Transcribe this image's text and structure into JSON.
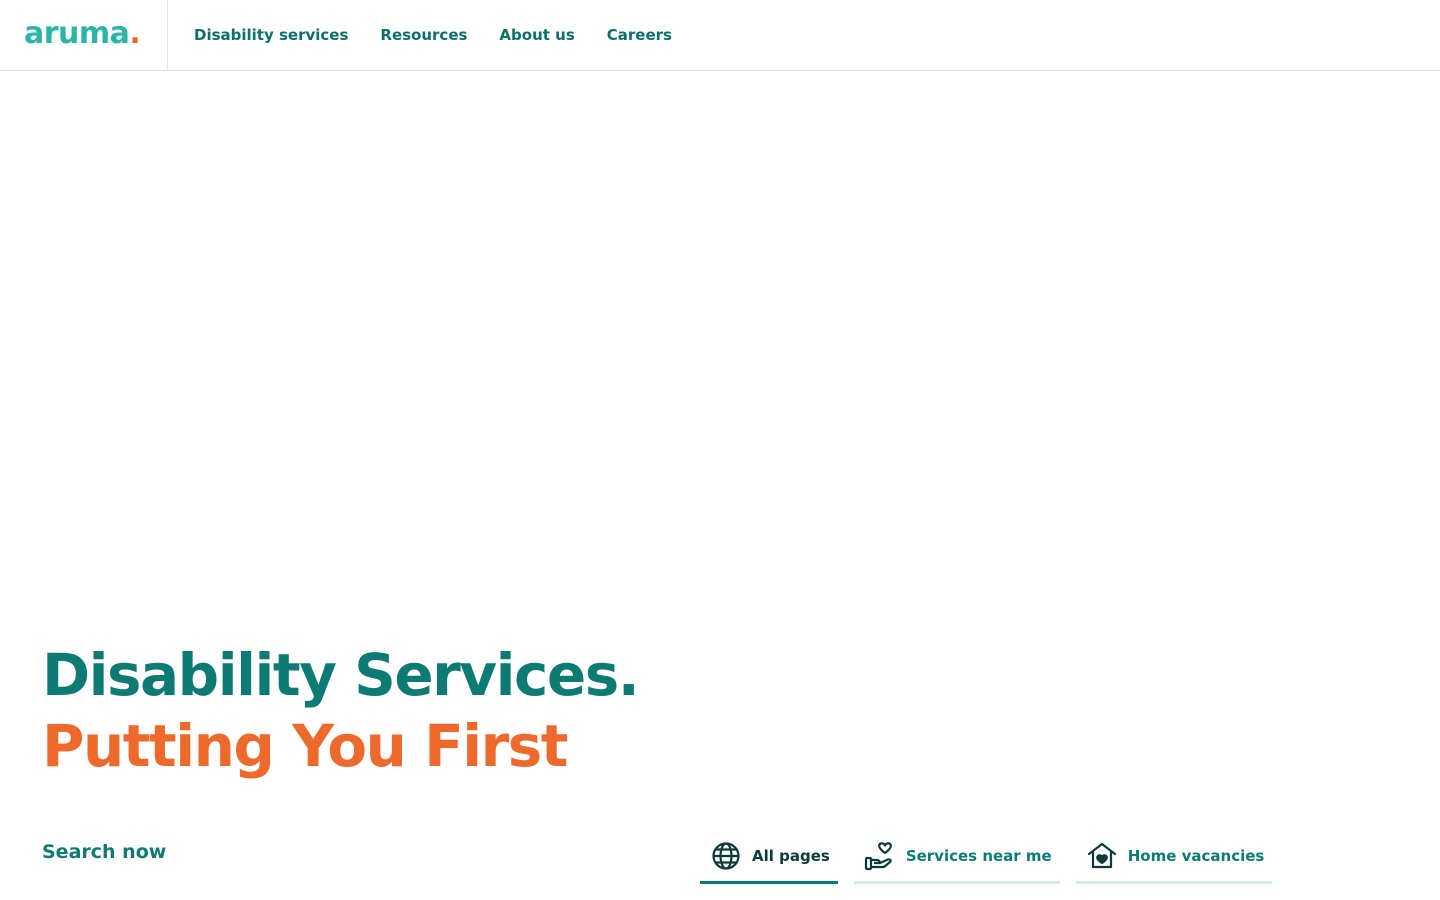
{
  "brand": {
    "logo_text": "aruma",
    "logo_dot": "."
  },
  "nav": {
    "items": [
      {
        "label": "Disability services"
      },
      {
        "label": "Resources"
      },
      {
        "label": "About us"
      },
      {
        "label": "Careers"
      }
    ]
  },
  "hero": {
    "title_line1": "Disability Services.",
    "title_line2": "Putting You First"
  },
  "search": {
    "label": "Search now",
    "tabs": [
      {
        "label": "All pages",
        "icon": "globe-icon",
        "active": true
      },
      {
        "label": "Services near me",
        "icon": "hand-heart-icon",
        "active": false
      },
      {
        "label": "Home vacancies",
        "icon": "house-heart-icon",
        "active": false
      }
    ]
  },
  "colors": {
    "teal": "#0d7b74",
    "logo_teal": "#2bb5a8",
    "orange": "#ee6a2c",
    "dark": "#0b3a3a",
    "tab_underline": "#d3ecea"
  }
}
